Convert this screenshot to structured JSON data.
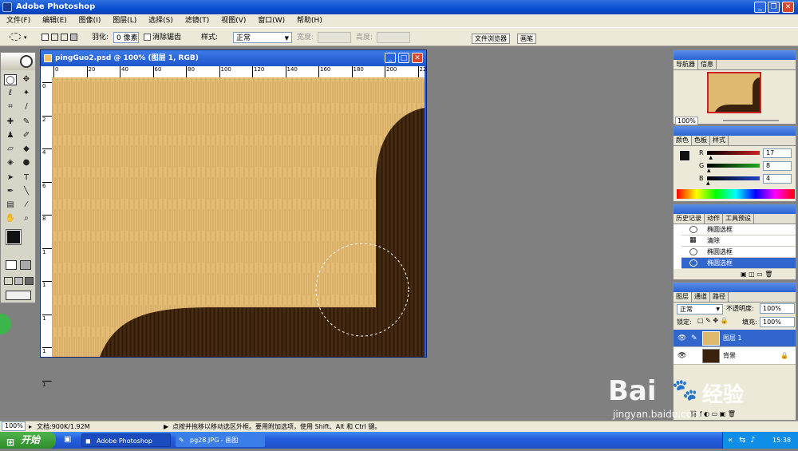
{
  "app": {
    "title": "Adobe Photoshop"
  },
  "menu": [
    "文件(F)",
    "编辑(E)",
    "图像(I)",
    "图层(L)",
    "选择(S)",
    "滤镜(T)",
    "视图(V)",
    "窗口(W)",
    "帮助(H)"
  ],
  "options": {
    "feather_label": "羽化:",
    "feather_value": "0 像素",
    "antialias_label": "消除锯齿",
    "style_label": "样式:",
    "style_value": "正常",
    "width_label": "宽度:",
    "height_label": "高度:",
    "tab_file_browser": "文件浏览器",
    "tab_brushes": "画笔"
  },
  "document": {
    "title": "pingGuo2.psd @ 100% (图层 1, RGB)",
    "ruler_marks": [
      "0",
      "20",
      "40",
      "60",
      "80",
      "100",
      "120",
      "140",
      "160",
      "180",
      "200",
      "22"
    ],
    "vruler_marks": [
      "0",
      "2",
      "4",
      "6",
      "8",
      "1",
      "1",
      "1",
      "1",
      "1"
    ]
  },
  "navigator": {
    "tabs": [
      "导航器",
      "信息"
    ],
    "zoom": "100%"
  },
  "color": {
    "tabs": [
      "颜色",
      "色板",
      "样式"
    ],
    "channels": [
      {
        "label": "R",
        "value": "17",
        "fraction": 0.067,
        "color": "#cc2222"
      },
      {
        "label": "G",
        "value": "8",
        "fraction": 0.031,
        "color": "#22aa22"
      },
      {
        "label": "B",
        "value": "4",
        "fraction": 0.016,
        "color": "#2244cc"
      }
    ]
  },
  "history": {
    "tabs": [
      "历史记录",
      "动作",
      "工具预设"
    ],
    "items": [
      "椭圆选框",
      "清除",
      "椭圆选框",
      "椭圆选框"
    ]
  },
  "layers": {
    "tabs": [
      "图层",
      "通道",
      "路径"
    ],
    "blend_mode": "正常",
    "opacity_label": "不透明度:",
    "opacity_value": "100%",
    "lock_label": "锁定:",
    "fill_label": "填充:",
    "fill_value": "100%",
    "items": [
      "图层 1",
      "背景"
    ]
  },
  "status": {
    "zoom": "100%",
    "doc": "文档:900K/1.92M",
    "hint": "点按并拖移以移动选区外框。要用附加选项，使用 Shift、Alt 和 Ctrl 键。"
  },
  "taskbar": {
    "start": "开始",
    "tasks": [
      "Adobe Photoshop",
      "pg28.JPG - 画图"
    ],
    "clock": "15:38"
  },
  "watermark": {
    "main": "Bai",
    "main2": "经验",
    "url": "jingyan.baidu.com"
  },
  "colors": {
    "wood_light": "#e0b970",
    "wood_dark": "#3a220c",
    "xp_blue": "#2b5bd8"
  }
}
